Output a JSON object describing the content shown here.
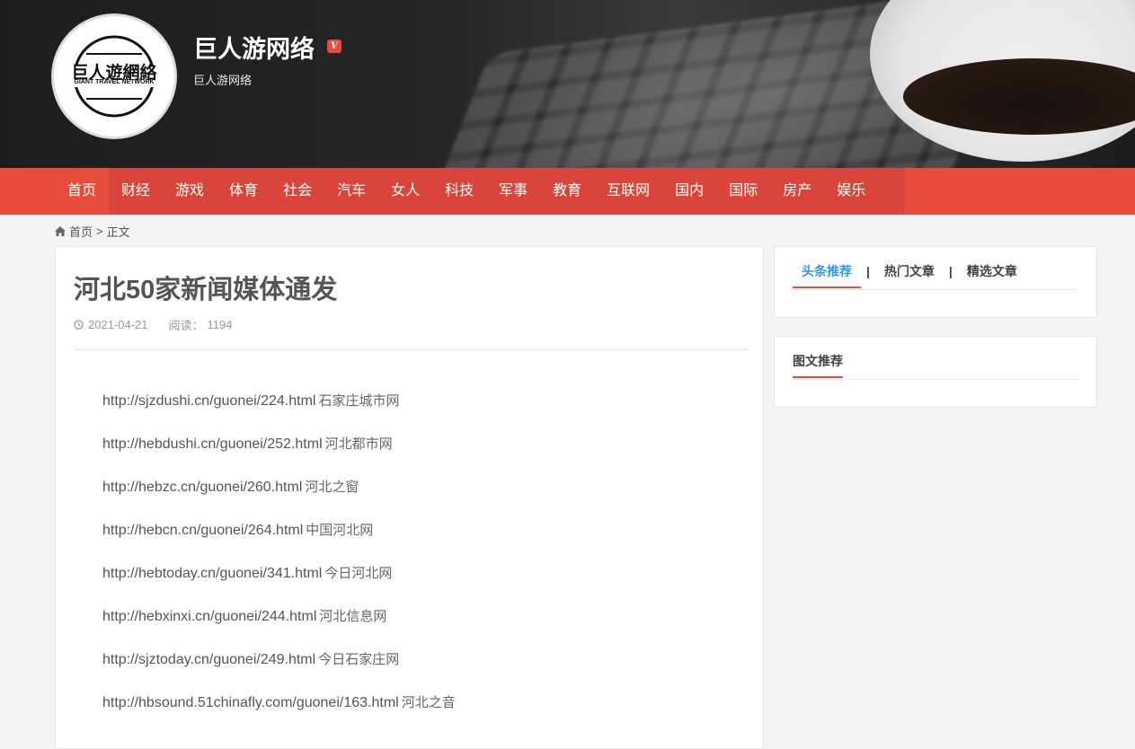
{
  "header": {
    "logo_cn": "巨人遊網絡",
    "logo_en": "GIANT TRAVEL NETWORK",
    "site_title": "巨人游网络",
    "vip_badge": "V",
    "site_subtitle": "巨人游网络"
  },
  "nav": {
    "items": [
      "首页",
      "财经",
      "游戏",
      "体育",
      "社会",
      "汽车",
      "女人",
      "科技",
      "军事",
      "教育",
      "互联网",
      "国内",
      "国际",
      "房产",
      "娱乐"
    ],
    "active_index": 0
  },
  "breadcrumb": {
    "home_icon": "home-icon",
    "home": "首页",
    "separator": ">",
    "current": "正文"
  },
  "article": {
    "title": "河北50家新闻媒体通发",
    "date_icon": "clock-icon",
    "date": "2021-04-21",
    "views_label": "阅读：",
    "views": "1194",
    "links": [
      {
        "url": "http://sjzdushi.cn/guonei/224.html",
        "name": "石家庄城市网"
      },
      {
        "url": "http://hebdushi.cn/guonei/252.html",
        "name": "河北都市网"
      },
      {
        "url": "http://hebzc.cn/guonei/260.html",
        "name": "河北之窗"
      },
      {
        "url": "http://hebcn.cn/guonei/264.html",
        "name": "中国河北网"
      },
      {
        "url": "http://hebtoday.cn/guonei/341.html",
        "name": "今日河北网"
      },
      {
        "url": "http://hebxinxi.cn/guonei/244.html",
        "name": "河北信息网"
      },
      {
        "url": "http://sjztoday.cn/guonei/249.html",
        "name": "今日石家庄网"
      },
      {
        "url": "http://hbsound.51chinafly.com/guonei/163.html",
        "name": "河北之音"
      }
    ]
  },
  "sidebar": {
    "tabs": [
      "头条推荐",
      "热门文章",
      "精选文章"
    ],
    "tab_separator": "|",
    "active_tab": 0,
    "pics_title": "图文推荐"
  },
  "colors": {
    "nav_red": "#e74c3c",
    "tab_active_blue": "#3498db"
  }
}
